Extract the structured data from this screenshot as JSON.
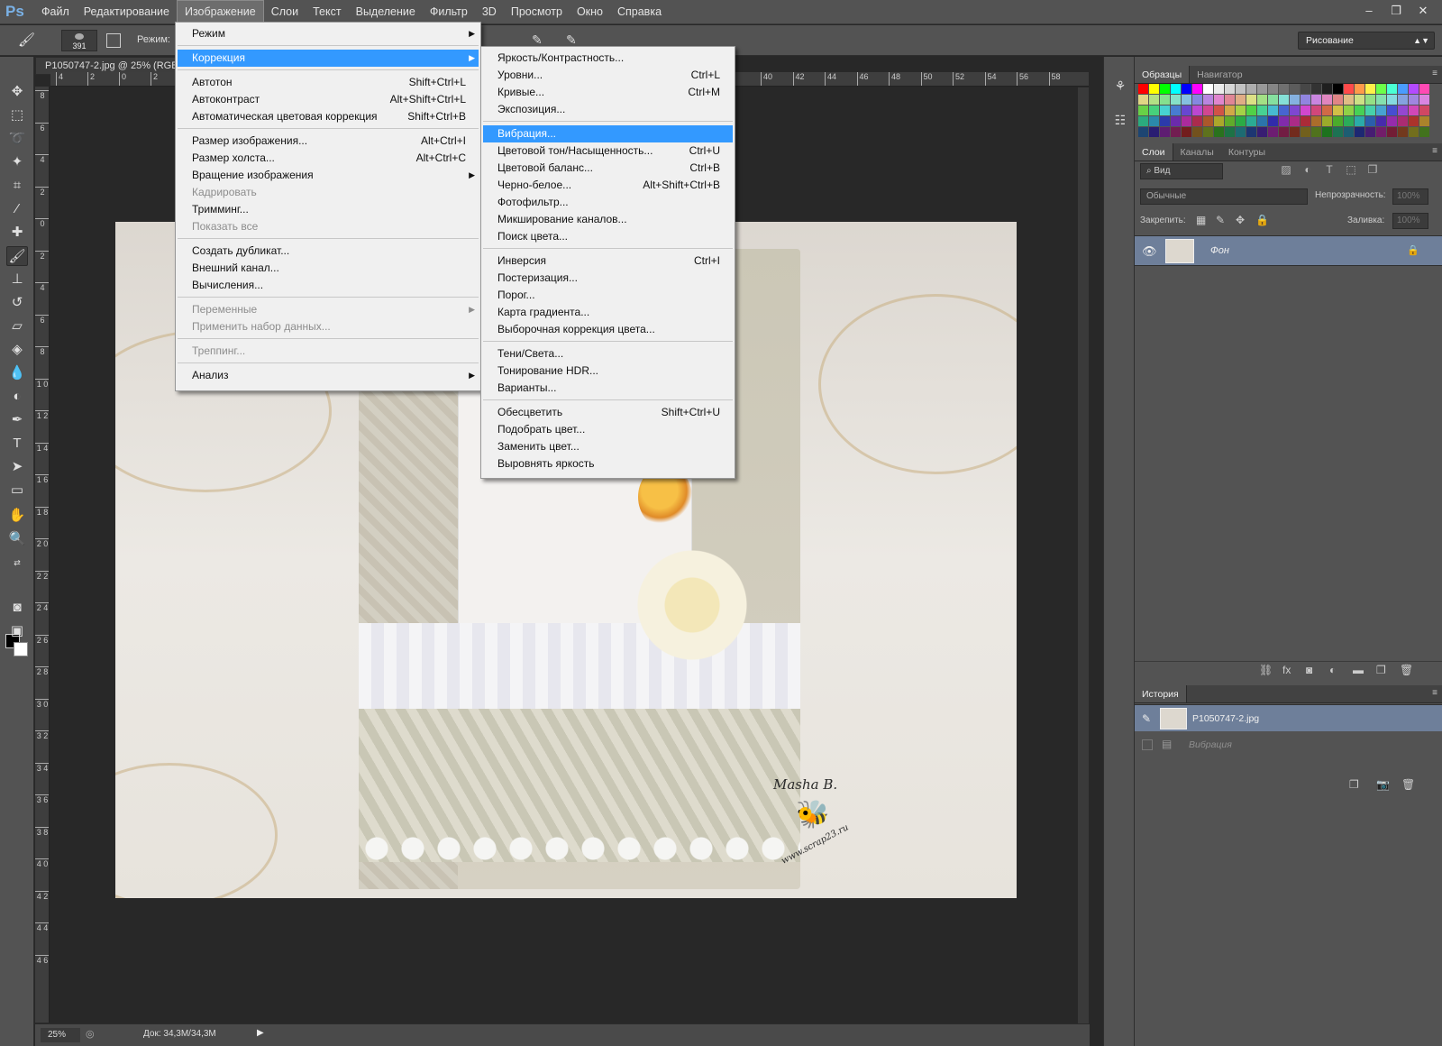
{
  "app": {
    "logo": "Ps"
  },
  "menubar": {
    "items": [
      "Файл",
      "Редактирование",
      "Изображение",
      "Слои",
      "Текст",
      "Выделение",
      "Фильтр",
      "3D",
      "Просмотр",
      "Окно",
      "Справка"
    ],
    "active": "Изображение",
    "window_controls": [
      "–",
      "❐",
      "✕"
    ]
  },
  "options_bar": {
    "brush_size": "391",
    "mode_label": "Режим:",
    "workspace": "Рисование"
  },
  "document": {
    "tab_title": "P1050747-2.jpg @ 25% (RGB",
    "ruler_h_left": [
      "4",
      "2",
      "0",
      "2"
    ],
    "ruler_h_right": [
      "40",
      "42",
      "44",
      "46",
      "48",
      "50",
      "52",
      "54",
      "56",
      "58"
    ],
    "ruler_v": [
      "8",
      "6",
      "4",
      "2",
      "0",
      "2",
      "4",
      "6",
      "8",
      "1 0",
      "1 2",
      "1 4",
      "1 6",
      "1 8",
      "2 0",
      "2 2",
      "2 4",
      "2 6",
      "2 8",
      "3 0",
      "3 2",
      "3 4",
      "3 6",
      "3 8",
      "4 0",
      "4 2",
      "4 4",
      "4 6"
    ],
    "watermark_name": "Masha B.",
    "watermark_url": "www.scrap23.ru"
  },
  "status_bar": {
    "zoom": "25%",
    "doc_size": "Док: 34,3M/34,3M"
  },
  "image_menu": {
    "items": [
      {
        "label": "Режим",
        "shortcut": "",
        "submenu": true,
        "disabled": false
      },
      {
        "label": "Коррекция",
        "shortcut": "",
        "submenu": true,
        "disabled": false,
        "highlighted": true
      },
      {
        "label": "Автотон",
        "shortcut": "Shift+Ctrl+L",
        "submenu": false,
        "disabled": false
      },
      {
        "label": "Автоконтраст",
        "shortcut": "Alt+Shift+Ctrl+L",
        "submenu": false,
        "disabled": false
      },
      {
        "label": "Автоматическая цветовая коррекция",
        "shortcut": "Shift+Ctrl+B",
        "submenu": false,
        "disabled": false
      },
      {
        "label": "Размер изображения...",
        "shortcut": "Alt+Ctrl+I",
        "submenu": false,
        "disabled": false
      },
      {
        "label": "Размер холста...",
        "shortcut": "Alt+Ctrl+C",
        "submenu": false,
        "disabled": false
      },
      {
        "label": "Вращение изображения",
        "shortcut": "",
        "submenu": true,
        "disabled": false
      },
      {
        "label": "Кадрировать",
        "shortcut": "",
        "submenu": false,
        "disabled": true
      },
      {
        "label": "Тримминг...",
        "shortcut": "",
        "submenu": false,
        "disabled": false
      },
      {
        "label": "Показать все",
        "shortcut": "",
        "submenu": false,
        "disabled": true
      },
      {
        "label": "Создать дубликат...",
        "shortcut": "",
        "submenu": false,
        "disabled": false
      },
      {
        "label": "Внешний канал...",
        "shortcut": "",
        "submenu": false,
        "disabled": false
      },
      {
        "label": "Вычисления...",
        "shortcut": "",
        "submenu": false,
        "disabled": false
      },
      {
        "label": "Переменные",
        "shortcut": "",
        "submenu": true,
        "disabled": true
      },
      {
        "label": "Применить набор данных...",
        "shortcut": "",
        "submenu": false,
        "disabled": true
      },
      {
        "label": "Треппинг...",
        "shortcut": "",
        "submenu": false,
        "disabled": true
      },
      {
        "label": "Анализ",
        "shortcut": "",
        "submenu": true,
        "disabled": false
      }
    ]
  },
  "adjustments_menu": {
    "items": [
      {
        "label": "Яркость/Контрастность...",
        "shortcut": ""
      },
      {
        "label": "Уровни...",
        "shortcut": "Ctrl+L"
      },
      {
        "label": "Кривые...",
        "shortcut": "Ctrl+M"
      },
      {
        "label": "Экспозиция...",
        "shortcut": ""
      },
      {
        "label": "Вибрация...",
        "shortcut": "",
        "highlighted": true
      },
      {
        "label": "Цветовой тон/Насыщенность...",
        "shortcut": "Ctrl+U"
      },
      {
        "label": "Цветовой баланс...",
        "shortcut": "Ctrl+B"
      },
      {
        "label": "Черно-белое...",
        "shortcut": "Alt+Shift+Ctrl+B"
      },
      {
        "label": "Фотофильтр...",
        "shortcut": ""
      },
      {
        "label": "Микширование каналов...",
        "shortcut": ""
      },
      {
        "label": "Поиск цвета...",
        "shortcut": ""
      },
      {
        "label": "Инверсия",
        "shortcut": "Ctrl+I"
      },
      {
        "label": "Постеризация...",
        "shortcut": ""
      },
      {
        "label": "Порог...",
        "shortcut": ""
      },
      {
        "label": "Карта градиента...",
        "shortcut": ""
      },
      {
        "label": "Выборочная коррекция цвета...",
        "shortcut": ""
      },
      {
        "label": "Тени/Света...",
        "shortcut": ""
      },
      {
        "label": "Тонирование HDR...",
        "shortcut": ""
      },
      {
        "label": "Варианты...",
        "shortcut": ""
      },
      {
        "label": "Обесцветить",
        "shortcut": "Shift+Ctrl+U"
      },
      {
        "label": "Подобрать цвет...",
        "shortcut": ""
      },
      {
        "label": "Заменить цвет...",
        "shortcut": ""
      },
      {
        "label": "Выровнять яркость",
        "shortcut": ""
      }
    ]
  },
  "swatches_panel": {
    "tabs": [
      "Образцы",
      "Навигатор"
    ]
  },
  "layers_panel": {
    "tabs": [
      "Слои",
      "Каналы",
      "Контуры"
    ],
    "search": "Вид",
    "blend_mode": "Обычные",
    "opacity_label": "Непрозрачность:",
    "opacity_value": "100%",
    "lock_label": "Закрепить:",
    "fill_label": "Заливка:",
    "fill_value": "100%",
    "layer_name": "Фон"
  },
  "history_panel": {
    "tab": "История",
    "snapshot": "P1050747-2.jpg",
    "step": "Вибрация"
  },
  "colors": {
    "menu_highlight": "#3399ff",
    "panel_bg": "#535353",
    "selected_row": "#6e7f9a"
  }
}
